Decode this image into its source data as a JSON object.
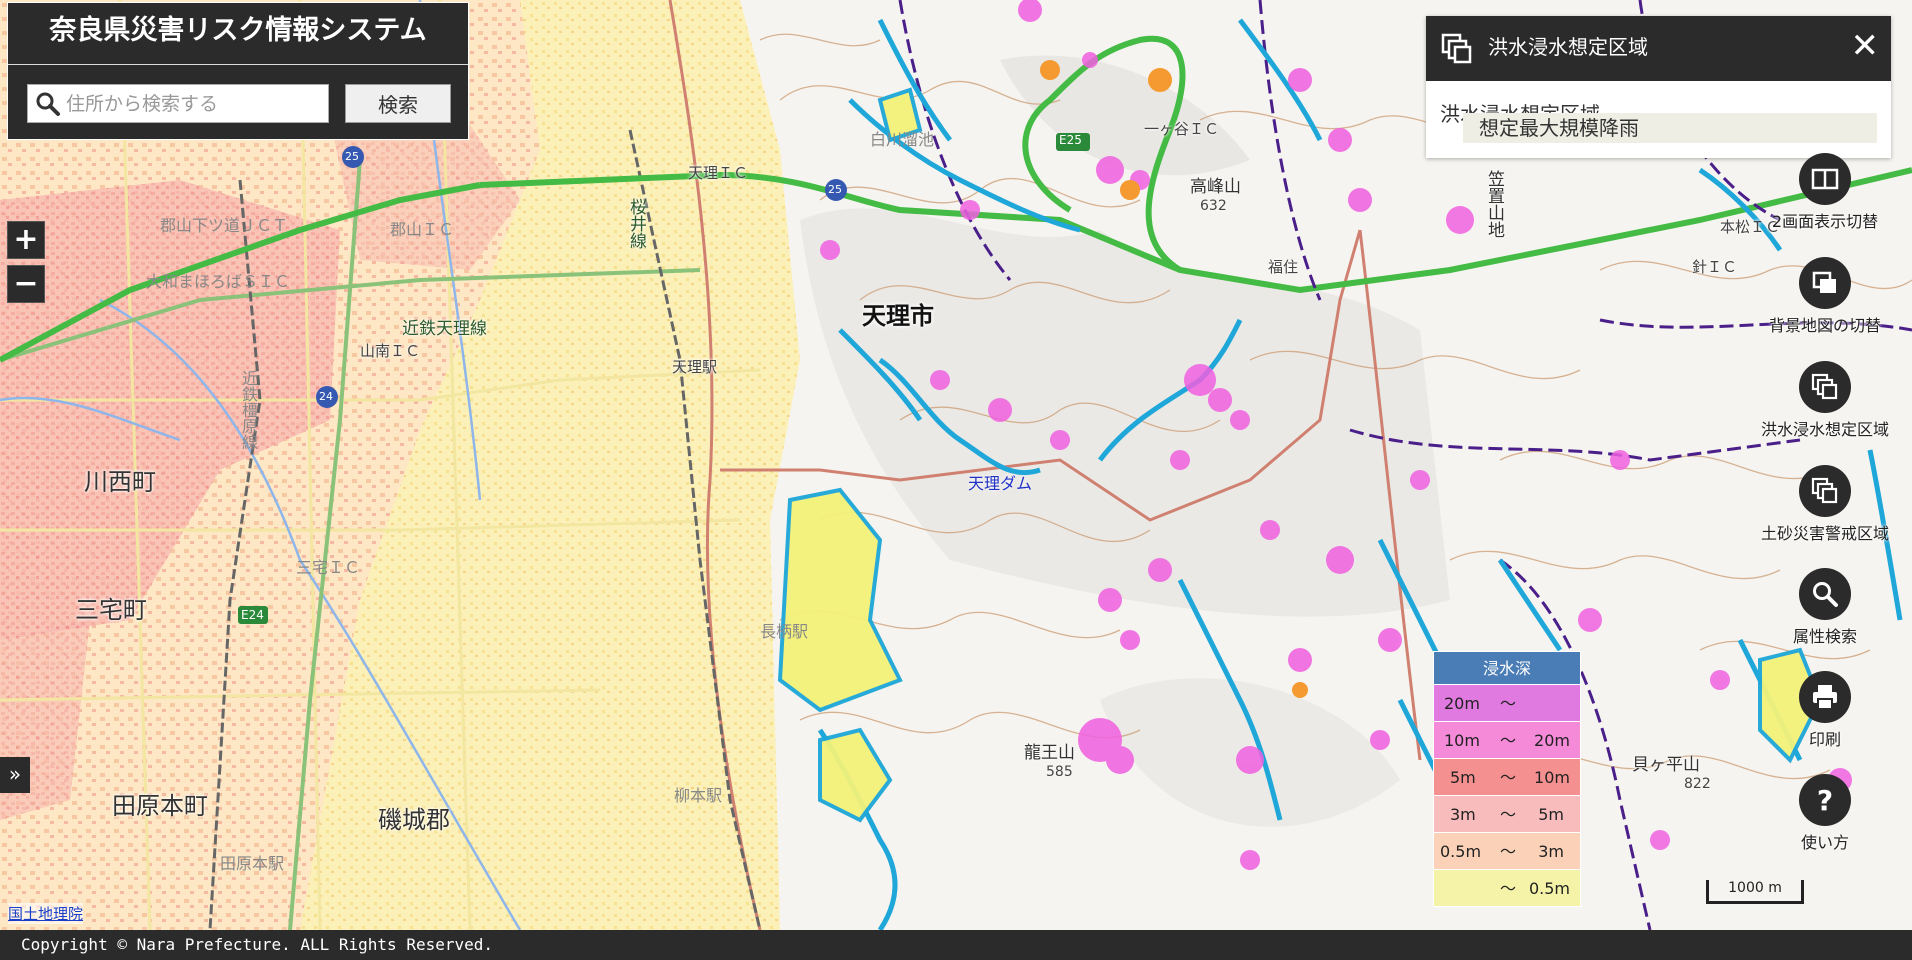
{
  "app": {
    "title": "奈良県災害リスク情報システム",
    "copyright": "Copyright © Nara Prefecture. ALL Rights Reserved."
  },
  "search": {
    "placeholder": "住所から検索する",
    "button_label": "検索"
  },
  "zoom": {
    "in_label": "+",
    "out_label": "−"
  },
  "sidebar_toggle_label": "»",
  "layer_panel": {
    "title": "洪水浸水想定区域",
    "close_label": "✕",
    "category": "洪水浸水想定区域",
    "selected_item": "想定最大規模降雨"
  },
  "tools": [
    {
      "label": "2画面表示切替",
      "icon": "split-screen-icon"
    },
    {
      "label": "背景地図の切替",
      "icon": "basemap-switch-icon"
    },
    {
      "label": "洪水浸水想定区域",
      "icon": "layers-icon"
    },
    {
      "label": "土砂災害警戒区域",
      "icon": "layers-icon"
    },
    {
      "label": "属性検索",
      "icon": "search-icon"
    },
    {
      "label": "印刷",
      "icon": "print-icon"
    },
    {
      "label": "使い方",
      "icon": "help-icon"
    }
  ],
  "legend": {
    "title": "浸水深",
    "rows": [
      {
        "from": "20m",
        "sep": "～",
        "to": "",
        "color": "#e07ae0"
      },
      {
        "from": "10m",
        "sep": "～",
        "to": "20m",
        "color": "#f48ad8"
      },
      {
        "from": "5m",
        "sep": "～",
        "to": "10m",
        "color": "#f59090"
      },
      {
        "from": "3m",
        "sep": "～",
        "to": "5m",
        "color": "#f8bcbc"
      },
      {
        "from": "0.5m",
        "sep": "～",
        "to": "3m",
        "color": "#fbd2b8"
      },
      {
        "from": "",
        "sep": "～",
        "to": "0.5m",
        "color": "#f5f3a8"
      }
    ]
  },
  "scale": {
    "label": "1000 m"
  },
  "attribution": "国土地理院",
  "map_labels": {
    "tenri_city": "天理市",
    "kawanishi": "川西町",
    "miyake": "三宅町",
    "tawaramoto": "田原本町",
    "shiki_gun": "磯城郡",
    "kintetsu_tenri": "近鉄天理線",
    "tenri_ic": "天理ＩＣ",
    "yamatokoriyama_jct": "郡山下ツ道ＪＣＴ",
    "koriyama_ic": "郡山ＩＣ",
    "mahoroba_sic": "大和まほろばＳＩＣ",
    "yamanami_ic": "山南ＩＣ",
    "miyake_ic": "三宅ＩＣ",
    "tenri_station": "天理駅",
    "nagara_station": "長柄駅",
    "yanagimoto_station": "柳本駅",
    "tawaramoto_station": "田原本駅",
    "sakurai_line": "桜井線",
    "kintetsu_kashihara": "近鉄橿原線",
    "shirakawa_pond": "白川溜池",
    "tenri_dam": "天理ダム",
    "ichigaya_ic": "一ヶ谷ＩＣ",
    "takamine": "高峰山",
    "takamine_elev": "632",
    "ryuo": "龍王山",
    "ryuo_elev": "585",
    "kaigahira": "貝ヶ平山",
    "kaigahira_elev": "822",
    "fukusumi": "福住",
    "harimichi_ic": "針ＩＣ",
    "harimichi_ic2": "本松ＩＣ",
    "e25": "E25",
    "r25": "25",
    "r24": "24",
    "e24": "E24",
    "r25b": "25",
    "kasugano": "笠置山地"
  }
}
